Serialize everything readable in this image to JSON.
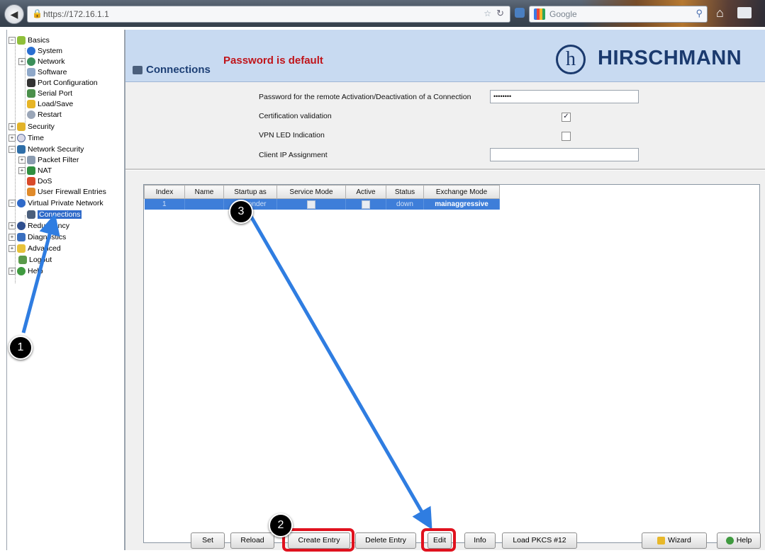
{
  "browser": {
    "url": "https://172.16.1.1",
    "search_engine": "Google"
  },
  "tree": {
    "items": [
      {
        "label": "Basics"
      },
      {
        "label": "System"
      },
      {
        "label": "Network"
      },
      {
        "label": "Software"
      },
      {
        "label": "Port Configuration"
      },
      {
        "label": "Serial Port"
      },
      {
        "label": "Load/Save"
      },
      {
        "label": "Restart"
      },
      {
        "label": "Security"
      },
      {
        "label": "Time"
      },
      {
        "label": "Network Security"
      },
      {
        "label": "Packet Filter"
      },
      {
        "label": "NAT"
      },
      {
        "label": "DoS"
      },
      {
        "label": "User Firewall Entries"
      },
      {
        "label": "Virtual Private Network"
      },
      {
        "label": "Connections"
      },
      {
        "label": "Redundancy"
      },
      {
        "label": "Diagnostics"
      },
      {
        "label": "Advanced"
      },
      {
        "label": "Logout"
      },
      {
        "label": "Help"
      }
    ]
  },
  "header": {
    "title": "Connections",
    "warning": "Password is default",
    "brand": "HIRSCHMANN",
    "logo_letter": "h"
  },
  "settings": {
    "password_label": "Password for the remote Activation/Deactivation of a Connection",
    "password_value": "••••••••",
    "cert_label": "Certification validation",
    "cert_checked": "✓",
    "vpn_led_label": "VPN LED Indication",
    "client_ip_label": "Client IP Assignment",
    "client_ip_value": ""
  },
  "table": {
    "headers": [
      "Index",
      "Name",
      "Startup as",
      "Service Mode",
      "Active",
      "Status",
      "Exchange Mode"
    ],
    "row": {
      "index": "1",
      "name": "",
      "startup": "responder",
      "status": "down",
      "exchange_mode": "mainaggressive"
    }
  },
  "buttons": {
    "set": "Set",
    "reload": "Reload",
    "create": "Create Entry",
    "delete": "Delete Entry",
    "edit": "Edit",
    "info": "Info",
    "pkcs": "Load PKCS #12",
    "wizard": "Wizard",
    "help": "Help"
  },
  "annotations": {
    "step1": "1",
    "step2": "2",
    "step3": "3",
    "highlight_color": "#e0121e",
    "arrow_color": "#2f7de1"
  }
}
